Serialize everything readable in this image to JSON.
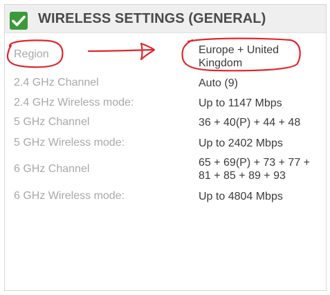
{
  "section": {
    "title": "WIRELESS SETTINGS (GENERAL)",
    "status_icon": "green-checkmark-icon"
  },
  "rows": [
    {
      "label": "Region",
      "value": "Europe + United Kingdom"
    },
    {
      "label": "2.4 GHz Channel",
      "value": "Auto (9)"
    },
    {
      "label": "2.4 GHz Wireless mode:",
      "value": "Up to 1147 Mbps"
    },
    {
      "label": "5 GHz Channel",
      "value": "36 + 40(P) + 44 + 48"
    },
    {
      "label": "5 GHz Wireless mode:",
      "value": "Up to 2402 Mbps"
    },
    {
      "label": "6 GHz Channel",
      "value": "65 + 69(P) + 73 + 77 + 81 + 85 + 89 + 93"
    },
    {
      "label": "6 GHz Wireless mode:",
      "value": "Up to 4804 Mbps"
    }
  ],
  "annotation": {
    "color": "#e0262b",
    "icon": "red-arrow-icon"
  }
}
